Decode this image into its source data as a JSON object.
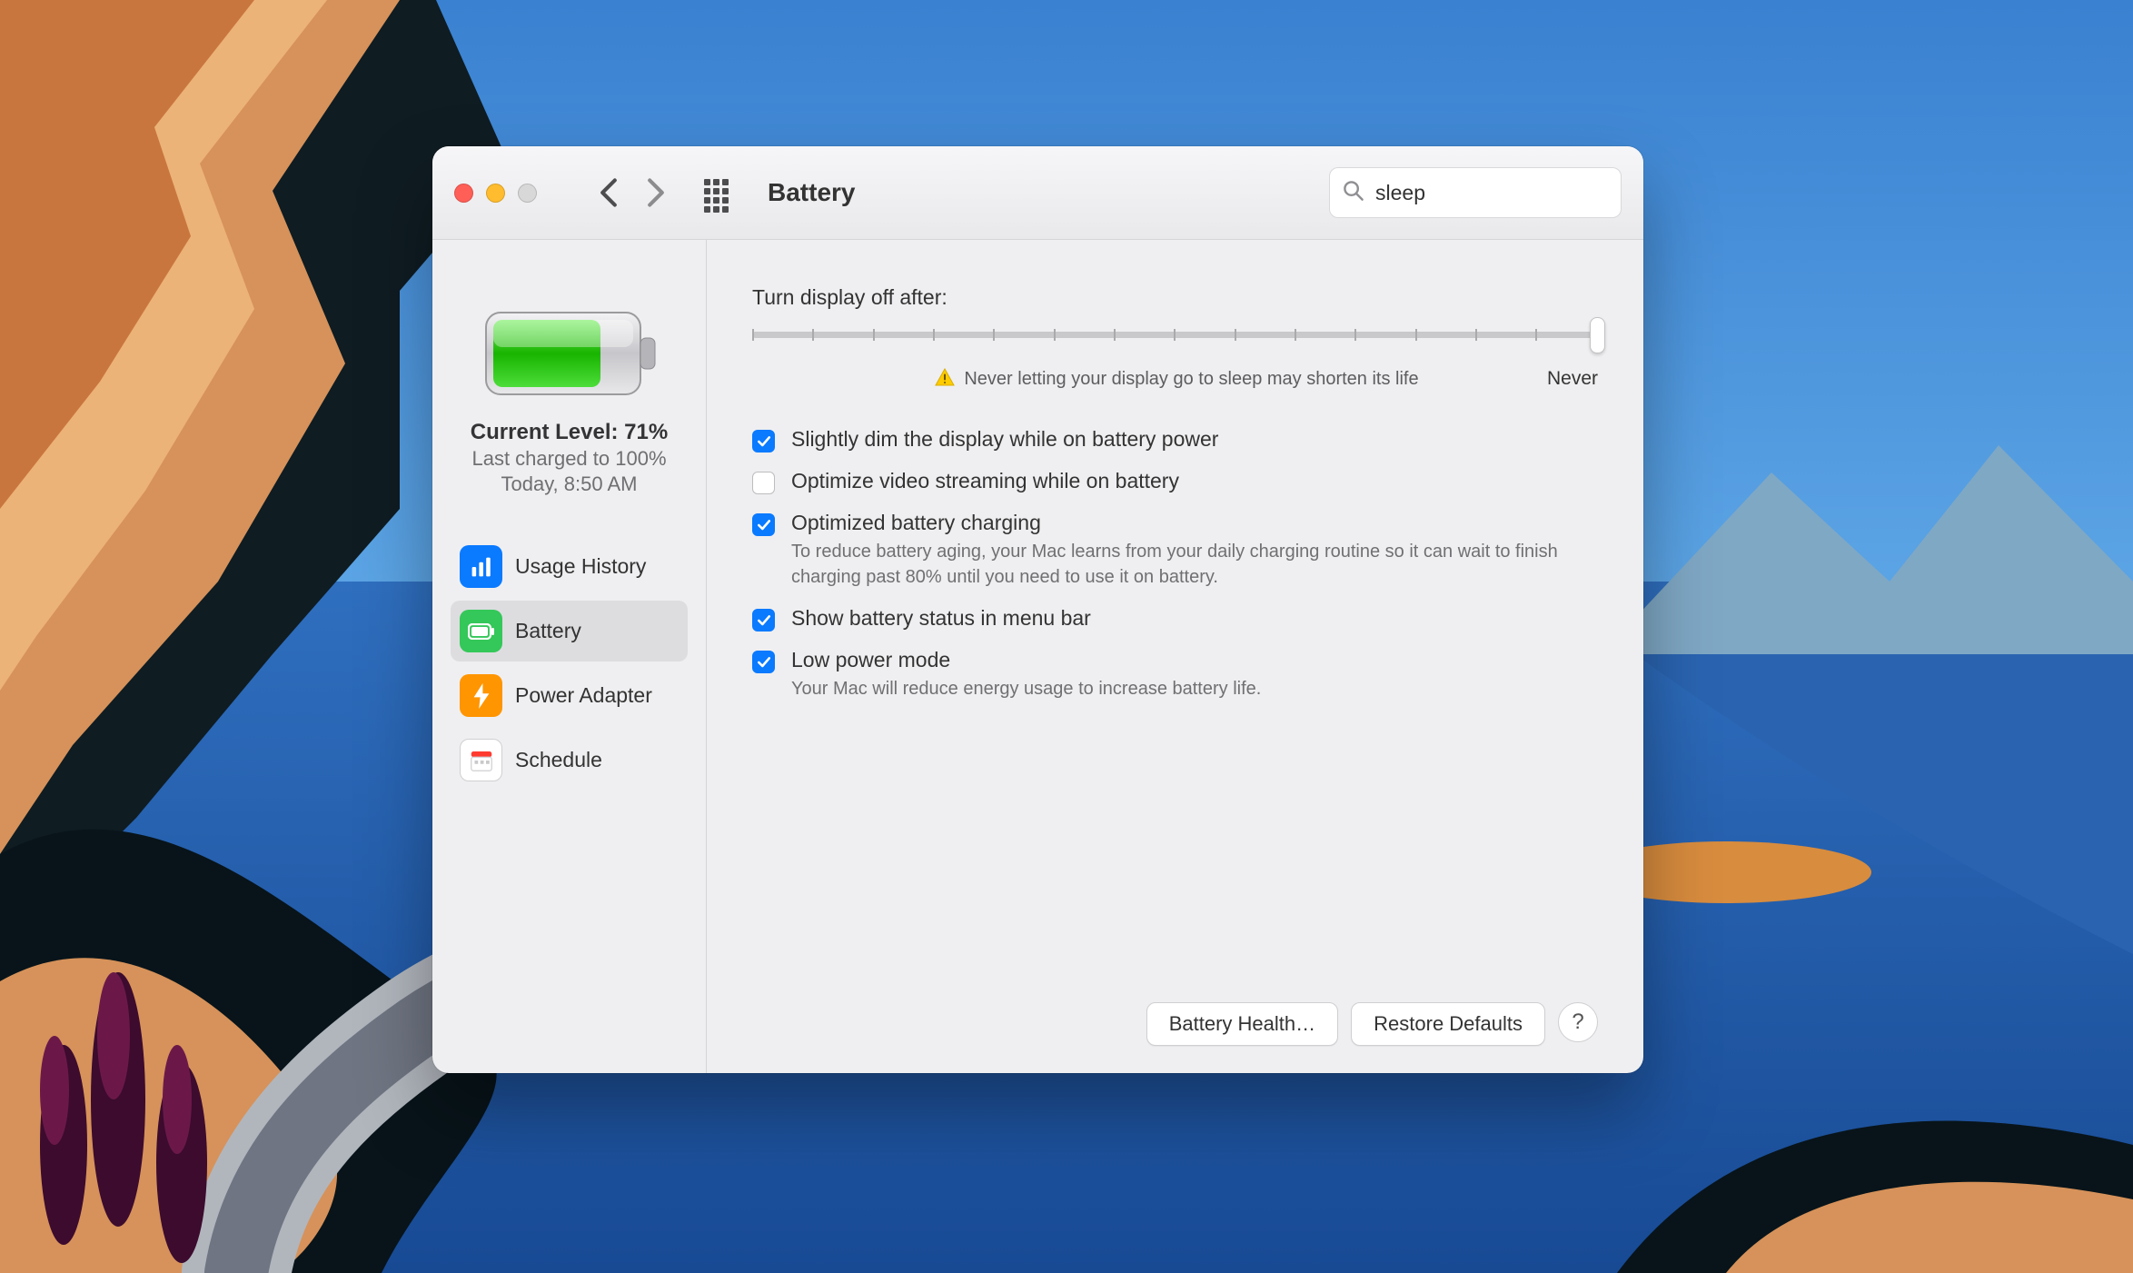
{
  "window": {
    "title": "Battery"
  },
  "search": {
    "value": "sleep"
  },
  "status": {
    "level_label": "Current Level: 71%",
    "last_charged": "Last charged to 100%",
    "when": "Today, 8:50 AM"
  },
  "sidebar": {
    "items": [
      {
        "label": "Usage History"
      },
      {
        "label": "Battery"
      },
      {
        "label": "Power Adapter"
      },
      {
        "label": "Schedule"
      }
    ],
    "selected": 1
  },
  "content": {
    "slider_label": "Turn display off after:",
    "never_label": "Never",
    "warning_text": "Never letting your display go to sleep may shorten its life",
    "options": {
      "dim": {
        "checked": true,
        "label": "Slightly dim the display while on battery power"
      },
      "stream": {
        "checked": false,
        "label": "Optimize video streaming while on battery"
      },
      "opt": {
        "checked": true,
        "label": "Optimized battery charging",
        "desc": "To reduce battery aging, your Mac learns from your daily charging routine so it can wait to finish charging past 80% until you need to use it on battery."
      },
      "menu": {
        "checked": true,
        "label": "Show battery status in menu bar"
      },
      "lowpow": {
        "checked": true,
        "label": "Low power mode",
        "desc": "Your Mac will reduce energy usage to increase battery life."
      }
    }
  },
  "footer": {
    "health_label": "Battery Health…",
    "restore_label": "Restore Defaults",
    "help_label": "?"
  }
}
